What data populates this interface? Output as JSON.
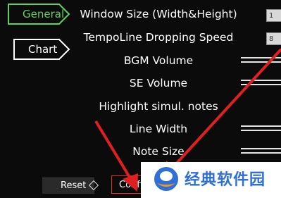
{
  "tabs": [
    {
      "label": "General",
      "selected": true
    },
    {
      "label": "Chart",
      "selected": false
    }
  ],
  "settings": [
    {
      "label": "Window Size (Width&Height)",
      "control": "number",
      "value": "1"
    },
    {
      "label": "TempoLine Dropping Speed",
      "control": "number",
      "value": "8"
    },
    {
      "label": "BGM Volume",
      "control": "slider"
    },
    {
      "label": "SE Volume",
      "control": "slider"
    },
    {
      "label": "Highlight simul. notes",
      "control": "none"
    },
    {
      "label": "Line Width",
      "control": "slider"
    },
    {
      "label": "Note Size",
      "control": "slider"
    }
  ],
  "buttons": {
    "reset_label": "Reset",
    "confirm_label": "Confi"
  },
  "watermark": {
    "text": "经典软件园"
  },
  "colors": {
    "background": "#0b0b0b",
    "tab_selected": "#5fd35f",
    "annotation_arrow": "#e02020",
    "watermark_blue": "#2f6fd8",
    "watermark_orange": "#f39a1e"
  }
}
